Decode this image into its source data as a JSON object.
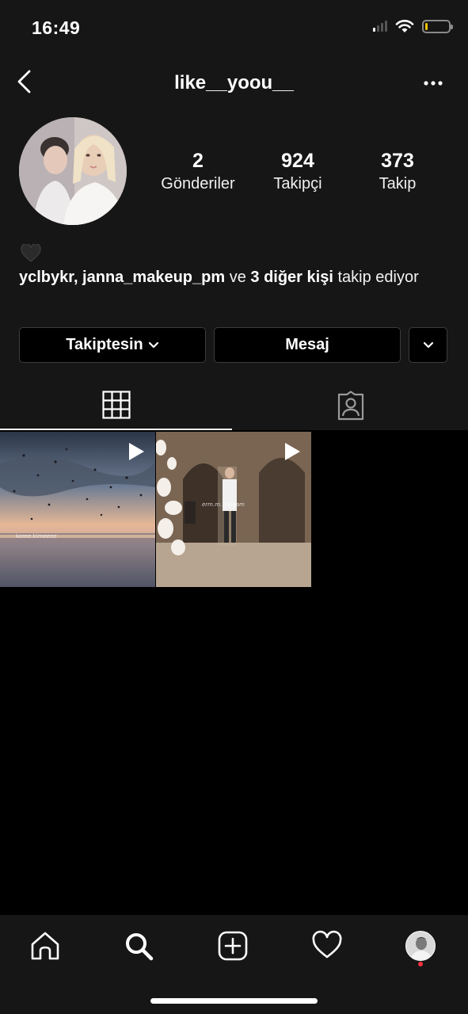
{
  "status_bar": {
    "time": "16:49",
    "battery_level": 0.12
  },
  "header": {
    "username": "like__yoou__"
  },
  "profile": {
    "stats": [
      {
        "value": "2",
        "label": "Gönderiler"
      },
      {
        "value": "924",
        "label": "Takipçi"
      },
      {
        "value": "373",
        "label": "Takip"
      }
    ],
    "bio_emoji": "black-heart-icon",
    "followed_by": {
      "names": "yclbykr, janna_makeup_pm",
      "connector": " ve ",
      "others": "3 diğer kişi",
      "suffix": " takip ediyor"
    }
  },
  "actions": {
    "following_label": "Takiptesin",
    "message_label": "Mesaj"
  },
  "tabs": [
    {
      "icon": "grid-icon",
      "active": true
    },
    {
      "icon": "tagged-person-icon",
      "active": false
    }
  ],
  "posts": [
    {
      "type": "video",
      "watermark": "koree.kimeeee"
    },
    {
      "type": "video",
      "watermark": "erm.m.. nagam"
    }
  ],
  "bottom_nav": [
    "home-icon",
    "search-icon",
    "add-post-icon",
    "heart-icon",
    "profile-avatar"
  ],
  "colors": {
    "background": "#000000",
    "surface": "#161616",
    "notification": "#ff3040",
    "battery": "#f5c400"
  }
}
